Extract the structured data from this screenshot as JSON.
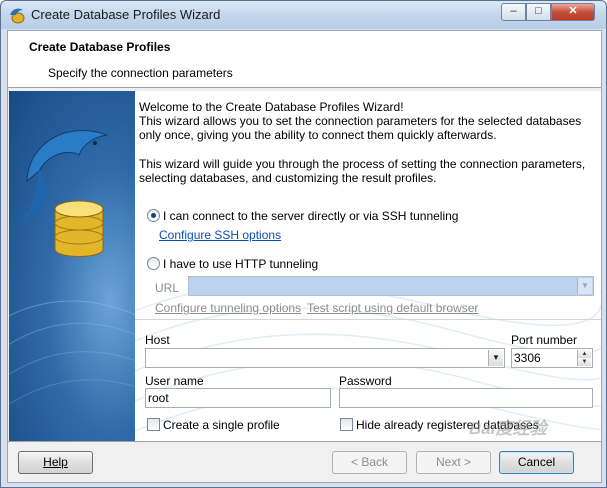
{
  "window": {
    "title": "Create Database Profiles Wizard",
    "controls": {
      "minimize": "–",
      "maximize": "□",
      "close": "✕"
    }
  },
  "header": {
    "title": "Create Database Profiles",
    "subtitle": "Specify the connection parameters"
  },
  "intro": {
    "welcome": "Welcome to the Create Database Profiles Wizard!",
    "paragraph1": "This wizard allows you to set the connection parameters for the selected databases only once, giving you the ability to connect them quickly afterwards.",
    "paragraph2": "This wizard will guide you through the process of setting the connection parameters, selecting databases, and customizing the result profiles."
  },
  "connection": {
    "option_direct": {
      "label": "I can connect to the server directly or via SSH tunneling",
      "selected": true
    },
    "ssh_link": "Configure SSH options",
    "option_http": {
      "label": "I have to use HTTP tunneling",
      "selected": false
    },
    "url_label": "URL",
    "url_value": "",
    "tunnel_link": "Configure tunneling options",
    "test_link": "Test script using default browser"
  },
  "form": {
    "host_label": "Host",
    "host_value": "",
    "port_label": "Port number",
    "port_value": "3306",
    "user_label": "User name",
    "user_value": "root",
    "password_label": "Password",
    "password_value": "",
    "single_profile": {
      "label": "Create a single profile",
      "checked": false
    },
    "hide_registered": {
      "label": "Hide already registered databases",
      "checked": false
    }
  },
  "footer": {
    "help": "Help",
    "back": "< Back",
    "next": "Next >",
    "cancel": "Cancel"
  },
  "watermark": "Bai度经验",
  "colors": {
    "accent": "#0b4fb5",
    "sidebar": "#2f6aa8",
    "url_field": "#bcd2ef"
  },
  "icons": {
    "app": "dolphin-database-icon",
    "sidebar": "dolphin-database-icon"
  }
}
